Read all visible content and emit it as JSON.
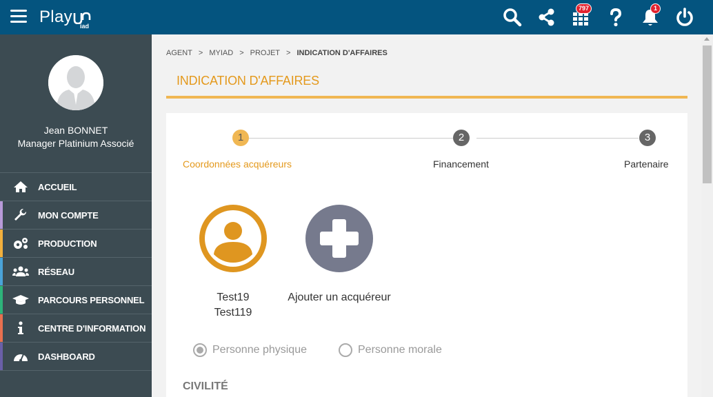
{
  "header": {
    "logo_main": "Play",
    "logo_sub": "iad",
    "grid_badge": "797",
    "bell_badge": "1",
    "bar_color": "#04547f"
  },
  "user": {
    "name": "Jean BONNET",
    "role": "Manager Platinium Associé"
  },
  "menu": [
    {
      "label": "ACCUEIL",
      "icon": "home-icon",
      "color": "#3c4b52"
    },
    {
      "label": "MON COMPTE",
      "icon": "wrench-icon",
      "color": "#b89ad9"
    },
    {
      "label": "PRODUCTION",
      "icon": "gears-icon",
      "color": "#f2b03d"
    },
    {
      "label": "RÉSEAU",
      "icon": "users-icon",
      "color": "#4aa3d9"
    },
    {
      "label": "PARCOURS PERSONNEL",
      "icon": "graduation-cap-icon",
      "color": "#2db37a"
    },
    {
      "label": "CENTRE D'INFORMATION",
      "icon": "info-icon",
      "color": "#e8704f"
    },
    {
      "label": "DASHBOARD",
      "icon": "dashboard-icon",
      "color": "#6a5fa8"
    }
  ],
  "breadcrumb": {
    "items": [
      "AGENT",
      "MYIAD",
      "PROJET"
    ],
    "current": "INDICATION D'AFFAIRES"
  },
  "page": {
    "title": "INDICATION D'AFFAIRES",
    "accent": "#e4991c"
  },
  "steps": [
    {
      "number": "1",
      "label": "Coordonnées acquéreurs",
      "active": true
    },
    {
      "number": "2",
      "label": "Financement",
      "active": false
    },
    {
      "number": "3",
      "label": "Partenaire",
      "active": false
    }
  ],
  "acquirers": {
    "existing_line1": "Test19",
    "existing_line2": "Test119",
    "add_label": "Ajouter un acquéreur"
  },
  "person_type": {
    "option1": "Personne physique",
    "option2": "Personne morale",
    "selected": "Personne physique"
  },
  "section": {
    "civilite": "CIVILITÉ"
  }
}
